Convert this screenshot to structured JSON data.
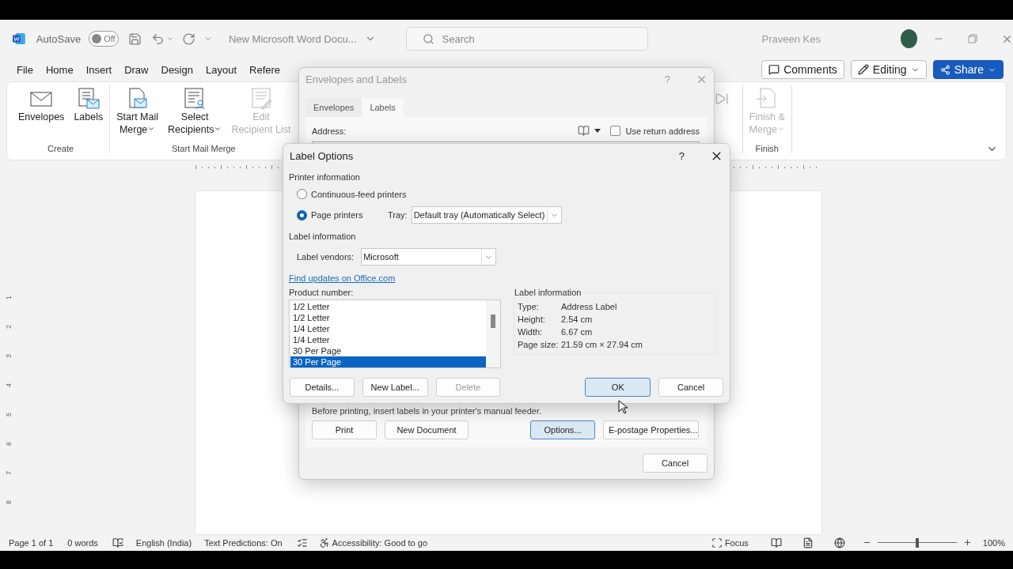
{
  "app": {
    "autosave": {
      "label": "AutoSave",
      "on": false,
      "state_text": "Off"
    },
    "document_title": "New Microsoft Word Docu...",
    "search": {
      "placeholder": "Search"
    },
    "user": "Praveen Kes"
  },
  "menu_tabs": [
    "File",
    "Home",
    "Insert",
    "Draw",
    "Design",
    "Layout",
    "Refere"
  ],
  "header_buttons": [
    {
      "kind": "comments",
      "label": "Comments"
    },
    {
      "kind": "editing",
      "label": "Editing"
    },
    {
      "kind": "share",
      "label": "Share"
    }
  ],
  "ribbon": {
    "groups": [
      {
        "label": "Create",
        "commands": [
          {
            "kind": "envelope",
            "label": "Envelopes",
            "dropdown": false,
            "disabled": false
          },
          {
            "kind": "labels",
            "label": "Labels",
            "dropdown": false,
            "disabled": false
          }
        ]
      },
      {
        "label": "Start Mail Merge",
        "commands": [
          {
            "kind": "start",
            "label": "Start Mail\nMerge",
            "dropdown": true,
            "disabled": false
          },
          {
            "kind": "recipients",
            "label": "Select\nRecipients",
            "dropdown": true,
            "disabled": false
          },
          {
            "kind": "edit-list",
            "label": "Edit\nRecipient List",
            "dropdown": false,
            "disabled": true
          }
        ]
      },
      {
        "label": "Finish",
        "commands": [
          {
            "kind": "finish",
            "label": "Finish &\nMerge",
            "dropdown": true,
            "disabled": true
          }
        ]
      }
    ]
  },
  "vertical_ruler": [
    "1",
    "2",
    "3",
    "4",
    "5",
    "6",
    "7",
    "8"
  ],
  "envelopes_dialog": {
    "title": "Envelopes and Labels",
    "tabs": [
      {
        "label": "Envelopes",
        "selected": false
      },
      {
        "label": "Labels",
        "selected": true
      }
    ],
    "address_label": "Address:",
    "use_return_address": {
      "label": "Use return address",
      "checked": false
    },
    "note": "Before printing, insert labels in your printer's manual feeder.",
    "buttons": [
      {
        "label": "Print",
        "focused": false
      },
      {
        "label": "New Document",
        "focused": false
      },
      {
        "label": "Options...",
        "focused": true
      },
      {
        "label": "E-postage Properties...",
        "focused": false
      }
    ],
    "cancel": "Cancel"
  },
  "label_options": {
    "title": "Label Options",
    "help": "?",
    "printer_section": "Printer information",
    "printer_types": [
      {
        "label": "Continuous-feed printers",
        "selected": false
      },
      {
        "label": "Page printers",
        "selected": true
      }
    ],
    "tray": {
      "label": "Tray:",
      "value": "Default tray (Automatically Select)"
    },
    "label_section": "Label information",
    "vendors": {
      "label": "Label vendors:",
      "value": "Microsoft"
    },
    "link": "Find updates on Office.com",
    "product_label": "Product number:",
    "products": [
      {
        "label": "1/2 Letter",
        "selected": false
      },
      {
        "label": "1/2 Letter",
        "selected": false
      },
      {
        "label": "1/4 Letter",
        "selected": false
      },
      {
        "label": "1/4 Letter",
        "selected": false
      },
      {
        "label": "30 Per Page",
        "selected": false
      },
      {
        "label": "30 Per Page",
        "selected": true
      }
    ],
    "info": {
      "title": "Label information",
      "rows": [
        {
          "key": "Type:",
          "value": "Address Label"
        },
        {
          "key": "Height:",
          "value": "2.54 cm"
        },
        {
          "key": "Width:",
          "value": "6.67 cm"
        },
        {
          "key": "Page size:",
          "value": "21.59 cm × 27.94 cm"
        }
      ]
    },
    "buttons": [
      {
        "label": "Details...",
        "disabled": false
      },
      {
        "label": "New Label...",
        "disabled": false
      },
      {
        "label": "Delete",
        "disabled": true
      }
    ],
    "ok": {
      "label": "OK",
      "focused": true
    },
    "cancel": {
      "label": "Cancel",
      "focused": false
    }
  },
  "status": {
    "page": "Page 1 of 1",
    "words": "0 words",
    "language": "English (India)",
    "predictions": "Text Predictions: On",
    "accessibility": "Accessibility: Good to go",
    "focus": "Focus",
    "zoom": {
      "level": 0.5,
      "text": "100%"
    }
  }
}
